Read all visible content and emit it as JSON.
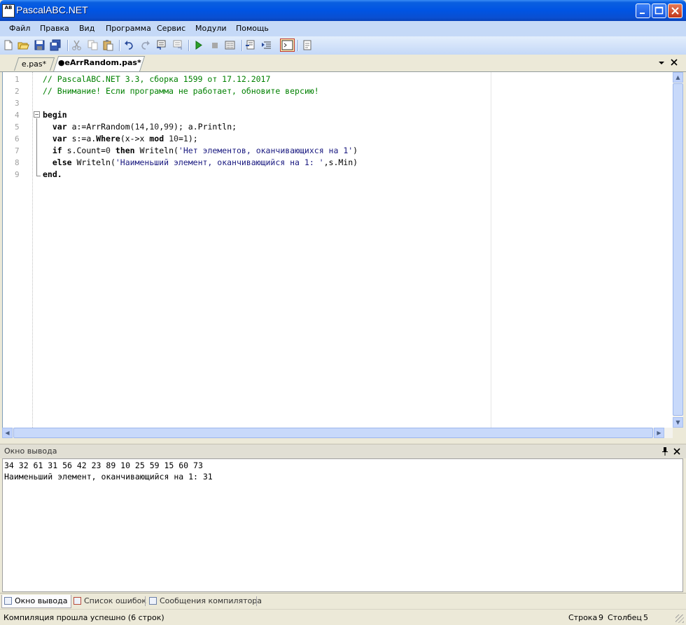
{
  "window": {
    "title": "PascalABC.NET",
    "icon_text": "AB"
  },
  "menu": [
    "Файл",
    "Правка",
    "Вид",
    "Программа",
    "Сервис",
    "Модули",
    "Помощь"
  ],
  "toolbar": {
    "icons": [
      "new-file-icon",
      "open-icon",
      "save-icon",
      "save-all-icon",
      "cut-icon",
      "copy-icon",
      "paste-icon",
      "undo-icon",
      "redo-icon",
      "comment-icon",
      "uncomment-icon",
      "run-icon",
      "stop-icon",
      "compile-icon",
      "step-into-icon",
      "step-over-icon",
      "console-icon",
      "output-icon"
    ]
  },
  "tabs": [
    {
      "label": "e.pas*",
      "active": false
    },
    {
      "label": "●eArrRandom.pas*",
      "active": true
    }
  ],
  "editor": {
    "line_numbers": [
      "1",
      "2",
      "3",
      "4",
      "5",
      "6",
      "7",
      "8",
      "9"
    ]
  },
  "output": {
    "title": "Окно вывода",
    "lines": [
      "34 32 61 31 56 42 23 89 10 25 59 15 60 73",
      "Наименьший элемент, оканчивающийся на 1: 31"
    ]
  },
  "bottom_tabs": [
    "Окно вывода",
    "Список ошибок",
    "Сообщения компилятора"
  ],
  "status": {
    "message": "Компиляция прошла успешно (6 строк)",
    "row_label": "Строка",
    "row": "9",
    "col_label": "Столбец",
    "col": "5"
  }
}
